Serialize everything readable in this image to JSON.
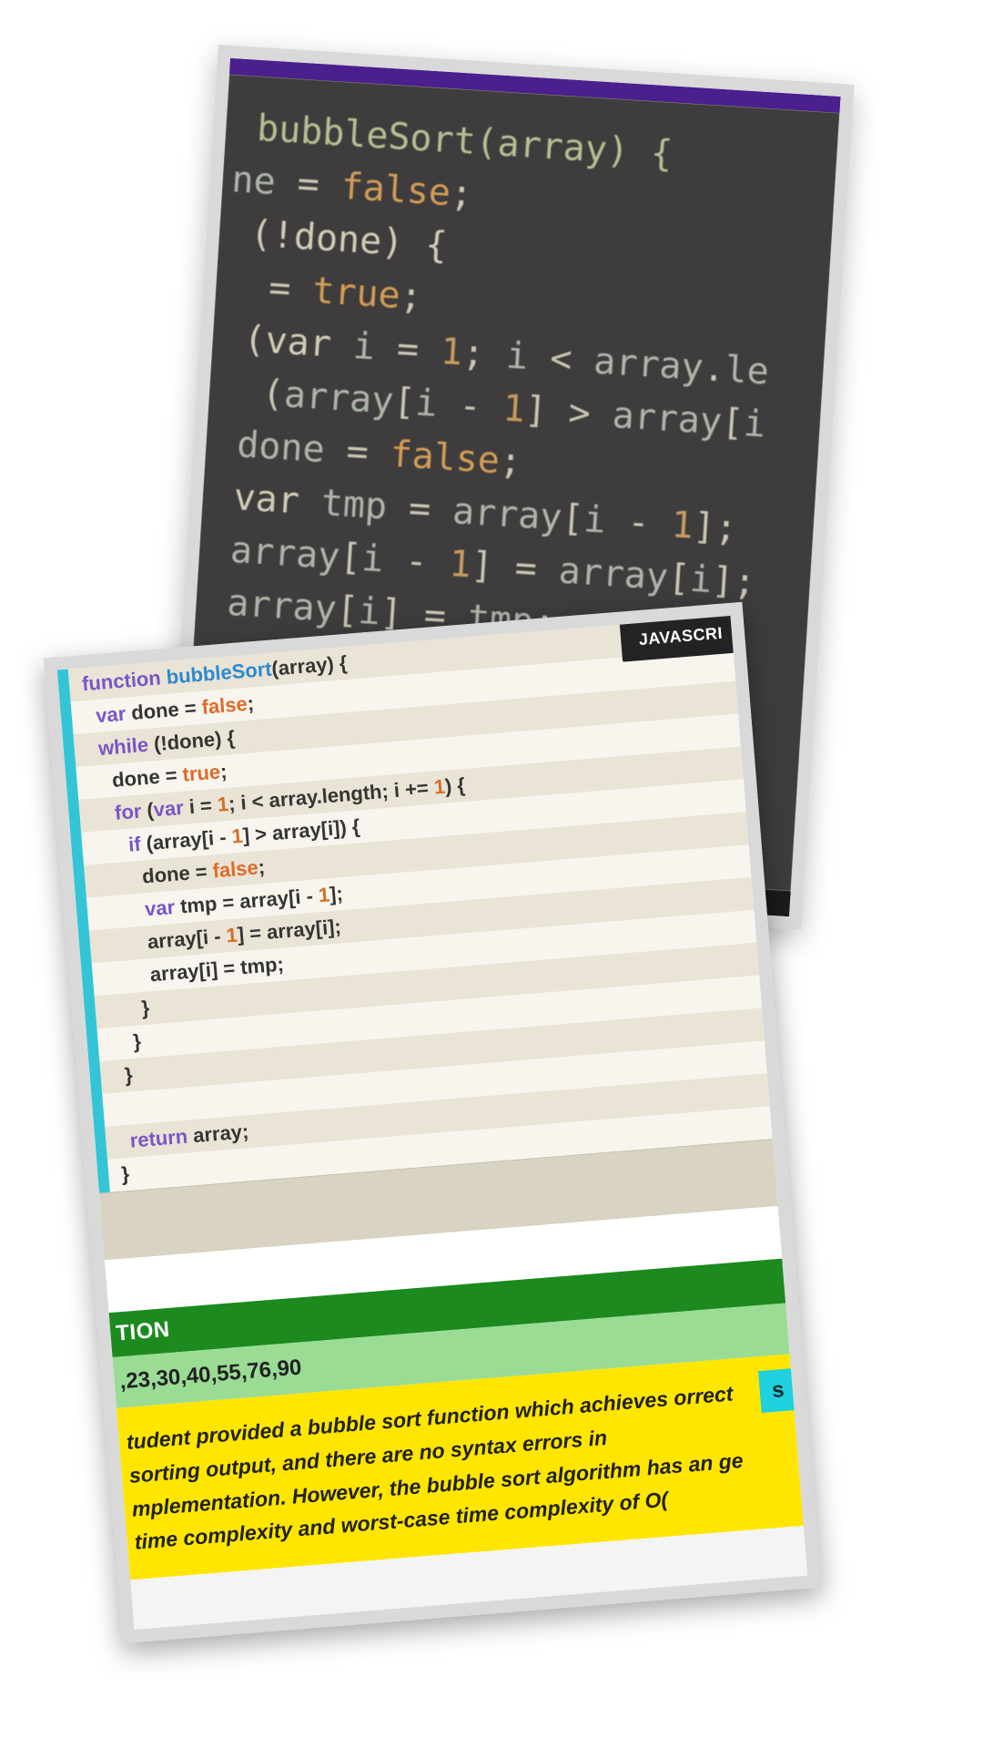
{
  "back_card": {
    "code_lines": [
      " bubbleSort(array) {",
      "ne = false;",
      " (!done) {",
      "  = true;",
      " (var i = 1; i < array.le",
      "  (array[i - 1] > array[i",
      " done = false;",
      " var tmp = array[i - 1];",
      " array[i - 1] = array[i];",
      " array[i] = tmp;"
    ]
  },
  "front_card": {
    "language_badge": "JAVASCRI",
    "code_lines": [
      "function bubbleSort(array) {",
      "  var done = false;",
      "  while (!done) {",
      "    done = true;",
      "    for (var i = 1; i < array.length; i += 1) {",
      "      if (array[i - 1] > array[i]) {",
      "        done = false;",
      "        var tmp = array[i - 1];",
      "        array[i - 1] = array[i];",
      "        array[i] = tmp;",
      "      }",
      "    }",
      "  }",
      " ",
      "  return array;",
      "}"
    ],
    "section_header": "TION",
    "result_row": ",23,30,40,55,76,90",
    "feedback_text": "tudent provided a bubble sort function which achieves orrect sorting output, and there are no syntax errors in mplementation. However, the bubble sort algorithm has an ge time complexity and worst-case time complexity of O(",
    "feedback_tag": "s"
  }
}
